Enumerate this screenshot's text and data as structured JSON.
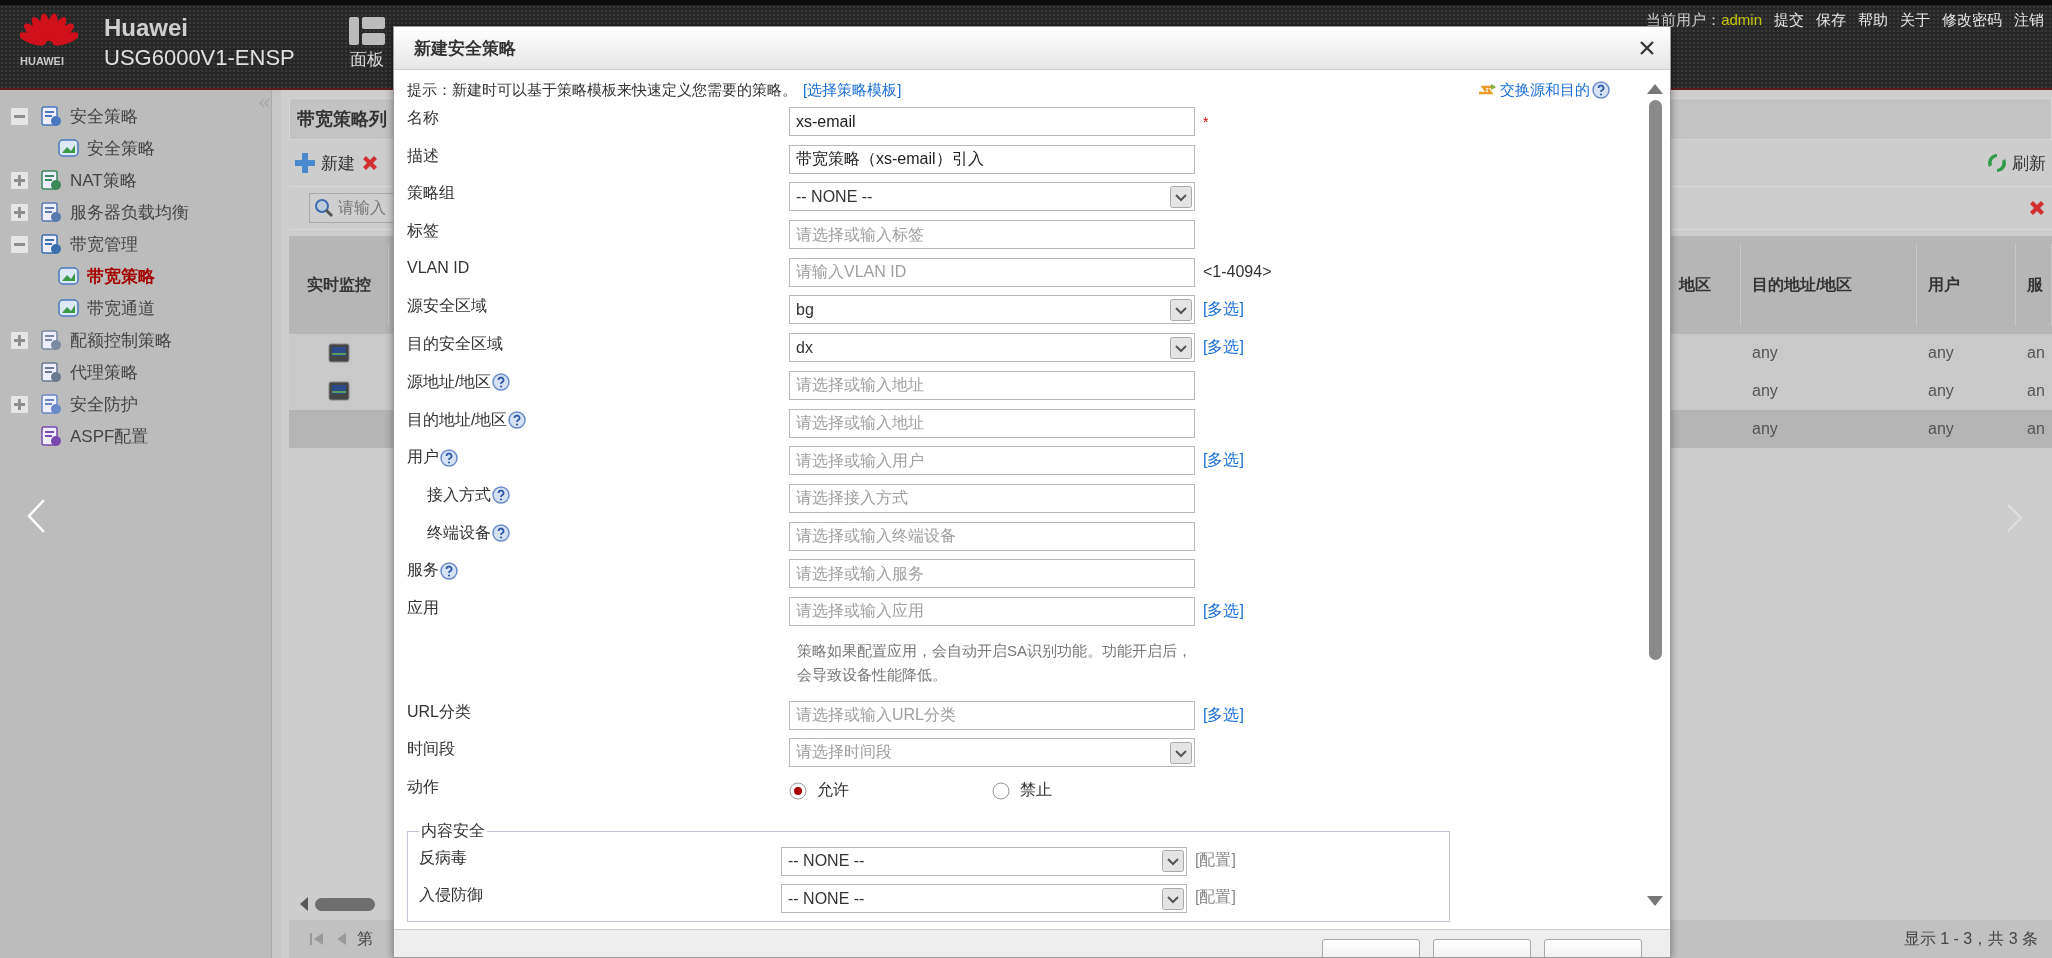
{
  "header": {
    "brand_mark": "HUAWEI",
    "brand": "Huawei",
    "model": "USG6000V1-ENSP",
    "dashboard": "面板",
    "user_label": "当前用户：",
    "user": "admin",
    "links": [
      "提交",
      "保存",
      "帮助",
      "关于",
      "修改密码",
      "注销"
    ]
  },
  "sidebar": {
    "items": [
      {
        "label": "安全策略",
        "kind": "folder",
        "expanded": true,
        "selected": false,
        "children": [
          {
            "label": "安全策略",
            "selected": false
          }
        ]
      },
      {
        "label": "NAT策略",
        "kind": "folder",
        "expanded": false,
        "selected": false
      },
      {
        "label": "服务器负载均衡",
        "kind": "folder",
        "expanded": false,
        "selected": false
      },
      {
        "label": "带宽管理",
        "kind": "folder",
        "expanded": true,
        "selected": false,
        "children": [
          {
            "label": "带宽策略",
            "selected": true
          },
          {
            "label": "带宽通道",
            "selected": false
          }
        ]
      },
      {
        "label": "配额控制策略",
        "kind": "folder",
        "expanded": false,
        "selected": false
      },
      {
        "label": "代理策略",
        "kind": "leaf",
        "selected": false
      },
      {
        "label": "安全防护",
        "kind": "folder",
        "expanded": false,
        "selected": false
      },
      {
        "label": "ASPF配置",
        "kind": "leaf",
        "selected": false
      }
    ]
  },
  "main": {
    "title": "带宽策略列",
    "toolbar": {
      "new": "新建",
      "refresh": "刷新"
    },
    "search": {
      "placeholder": "请输入"
    },
    "table": {
      "columns": [
        "实时监控",
        "地区",
        "目的地址/地区",
        "用户",
        "服"
      ],
      "rows": [
        {
          "monitor": true,
          "selected": false,
          "cells": [
            "",
            "",
            "any",
            "any",
            "an"
          ]
        },
        {
          "monitor": true,
          "selected": false,
          "cells": [
            "",
            "",
            "any",
            "any",
            "an"
          ]
        },
        {
          "monitor": false,
          "selected": true,
          "cells": [
            "",
            "",
            "any",
            "any",
            "an"
          ]
        }
      ]
    },
    "pagination": {
      "page_label": "第",
      "summary": "显示 1 - 3，共 3 条"
    }
  },
  "dialog": {
    "title": "新建安全策略",
    "hint": "提示：新建时可以基于策略模板来快速定义您需要的策略。",
    "template_link": "[选择策略模板]",
    "swap_link": "交换源和目的",
    "fields": [
      {
        "label": "名称",
        "kind": "text",
        "value": "xs-email",
        "marker": "*"
      },
      {
        "label": "描述",
        "kind": "text",
        "value": "带宽策略（xs-email）引入"
      },
      {
        "label": "策略组",
        "kind": "select",
        "value": "-- NONE --"
      },
      {
        "label": "标签",
        "kind": "input",
        "placeholder": "请选择或输入标签"
      },
      {
        "label": "VLAN ID",
        "kind": "input",
        "placeholder": "请输入VLAN ID",
        "suffix": "<1-4094>"
      },
      {
        "label": "源安全区域",
        "kind": "select",
        "value": "bg",
        "link": "[多选]"
      },
      {
        "label": "目的安全区域",
        "kind": "select",
        "value": "dx",
        "link": "[多选]"
      },
      {
        "label": "源地址/地区",
        "kind": "input",
        "help": true,
        "placeholder": "请选择或输入地址"
      },
      {
        "label": "目的地址/地区",
        "kind": "input",
        "help": true,
        "placeholder": "请选择或输入地址"
      },
      {
        "label": "用户",
        "kind": "input",
        "help": true,
        "placeholder": "请选择或输入用户",
        "link": "[多选]",
        "children": [
          {
            "label": "接入方式",
            "kind": "input",
            "help": true,
            "placeholder": "请选择接入方式"
          },
          {
            "label": "终端设备",
            "kind": "input",
            "help": true,
            "placeholder": "请选择或输入终端设备"
          }
        ]
      },
      {
        "label": "服务",
        "kind": "input",
        "help": true,
        "placeholder": "请选择或输入服务"
      },
      {
        "label": "应用",
        "kind": "input",
        "placeholder": "请选择或输入应用",
        "link": "[多选]",
        "note": "策略如果配置应用，会自动开启SA识别功能。功能开启后，会导致设备性能降低。"
      },
      {
        "label": "URL分类",
        "kind": "input",
        "placeholder": "请选择或输入URL分类",
        "link": "[多选]"
      },
      {
        "label": "时间段",
        "kind": "select",
        "placeholder": "请选择时间段"
      },
      {
        "label": "动作",
        "kind": "radio",
        "options": [
          {
            "label": "允许",
            "selected": true
          },
          {
            "label": "禁止",
            "selected": false
          }
        ]
      }
    ],
    "security": {
      "legend": "内容安全",
      "items": [
        {
          "label": "反病毒",
          "value": "-- NONE --",
          "link": "[配置]"
        },
        {
          "label": "入侵防御",
          "value": "-- NONE --",
          "link": "[配置]"
        }
      ]
    }
  }
}
